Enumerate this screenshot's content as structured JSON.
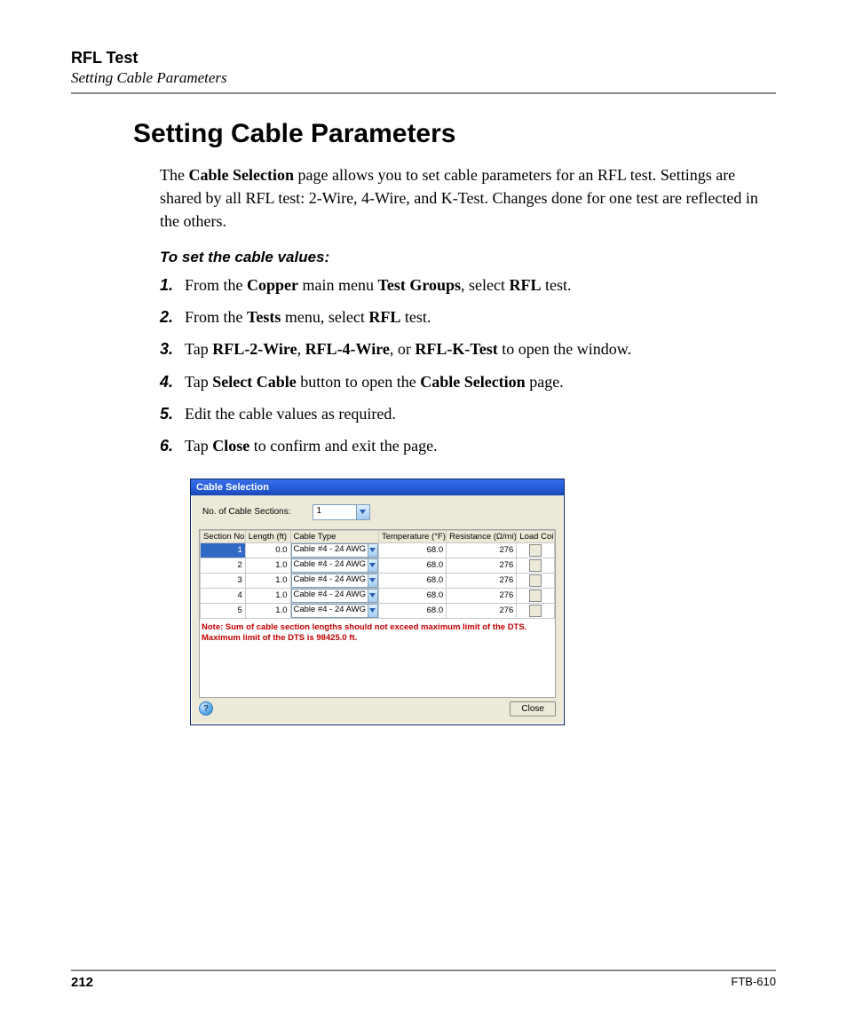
{
  "header": {
    "chapter": "RFL Test",
    "section": "Setting Cable Parameters"
  },
  "title": "Setting Cable Parameters",
  "intro": {
    "pre": "The ",
    "b1": "Cable Selection",
    "post": " page allows you to set cable parameters for an RFL test. Settings are shared by all RFL test: 2-Wire, 4-Wire, and K-Test. Changes done for one test are reflected in the others."
  },
  "subhead": "To set the cable values:",
  "steps": [
    {
      "n": "1.",
      "parts": [
        {
          "t": "From the "
        },
        {
          "b": "Copper"
        },
        {
          "t": " main menu "
        },
        {
          "b": "Test Groups"
        },
        {
          "t": ", select "
        },
        {
          "b": "RFL"
        },
        {
          "t": " test."
        }
      ]
    },
    {
      "n": "2.",
      "parts": [
        {
          "t": "From the "
        },
        {
          "b": "Tests"
        },
        {
          "t": " menu, select "
        },
        {
          "b": "RFL"
        },
        {
          "t": " test."
        }
      ]
    },
    {
      "n": "3.",
      "parts": [
        {
          "t": "Tap "
        },
        {
          "b": "RFL-2-Wire"
        },
        {
          "t": ", "
        },
        {
          "b": "RFL-4-Wire"
        },
        {
          "t": ", or "
        },
        {
          "b": "RFL-K-Test"
        },
        {
          "t": " to open the window."
        }
      ]
    },
    {
      "n": "4.",
      "parts": [
        {
          "t": "Tap "
        },
        {
          "b": "Select Cable"
        },
        {
          "t": " button to open the "
        },
        {
          "b": "Cable Selection"
        },
        {
          "t": " page."
        }
      ]
    },
    {
      "n": "5.",
      "parts": [
        {
          "t": "Edit the cable values as required."
        }
      ]
    },
    {
      "n": "6.",
      "parts": [
        {
          "t": "Tap "
        },
        {
          "b": "Close"
        },
        {
          "t": " to confirm and exit the page."
        }
      ]
    }
  ],
  "window": {
    "title": "Cable Selection",
    "sections_label": "No. of Cable Sections:",
    "sections_value": "1",
    "columns": {
      "section": "Section No.",
      "length": "Length (ft)",
      "type": "Cable Type",
      "temp": "Temperature (°F)",
      "res": "Resistance (Ω/mi)",
      "coil": "Load Coil"
    },
    "rows": [
      {
        "section": "1",
        "length": "0.0",
        "type": "Cable #4 - 24 AWG",
        "temp": "68.0",
        "res": "276",
        "selected": true
      },
      {
        "section": "2",
        "length": "1.0",
        "type": "Cable #4 - 24 AWG",
        "temp": "68.0",
        "res": "276",
        "selected": false
      },
      {
        "section": "3",
        "length": "1.0",
        "type": "Cable #4 - 24 AWG",
        "temp": "68.0",
        "res": "276",
        "selected": false
      },
      {
        "section": "4",
        "length": "1.0",
        "type": "Cable #4 - 24 AWG",
        "temp": "68.0",
        "res": "276",
        "selected": false
      },
      {
        "section": "5",
        "length": "1.0",
        "type": "Cable #4 - 24 AWG",
        "temp": "68.0",
        "res": "276",
        "selected": false
      }
    ],
    "note": "Note: Sum of cable section lengths should not exceed maximum limit of the DTS. Maximum limit of the DTS is 98425.0 ft.",
    "close_label": "Close",
    "help_glyph": "?"
  },
  "footer": {
    "page": "212",
    "doc": "FTB-610"
  }
}
